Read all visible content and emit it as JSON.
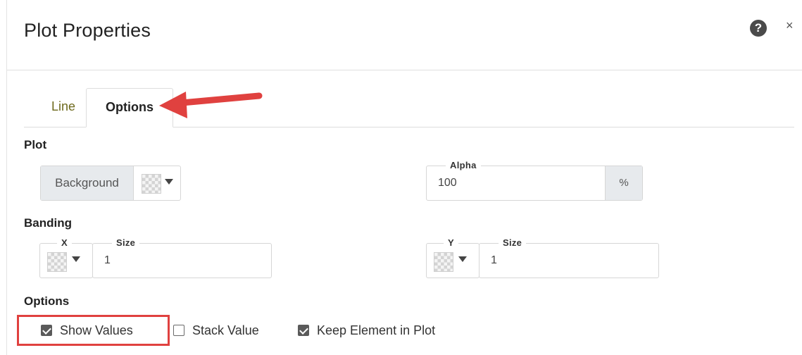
{
  "dialog": {
    "title": "Plot Properties",
    "help_symbol": "?",
    "close_symbol": "×"
  },
  "tabs": [
    {
      "label": "Line",
      "active": false
    },
    {
      "label": "Options",
      "active": true
    }
  ],
  "plot": {
    "section_label": "Plot",
    "background_label": "Background",
    "alpha_label": "Alpha",
    "alpha_value": "100",
    "alpha_suffix": "%"
  },
  "banding": {
    "section_label": "Banding",
    "x_label": "X",
    "x_size_label": "Size",
    "x_size_value": "1",
    "y_label": "Y",
    "y_size_label": "Size",
    "y_size_value": "1"
  },
  "options": {
    "section_label": "Options",
    "checkboxes": [
      {
        "label": "Show Values",
        "checked": true
      },
      {
        "label": "Stack Value",
        "checked": false
      },
      {
        "label": "Keep Element in Plot",
        "checked": true
      }
    ]
  },
  "annotation_colors": {
    "arrow": "#e0413f",
    "highlight_box": "#e0413f"
  },
  "icons": {
    "help": "help-icon",
    "close": "close-icon",
    "pattern": "pattern-swatch-icon",
    "dropdown": "caret-down-icon"
  }
}
